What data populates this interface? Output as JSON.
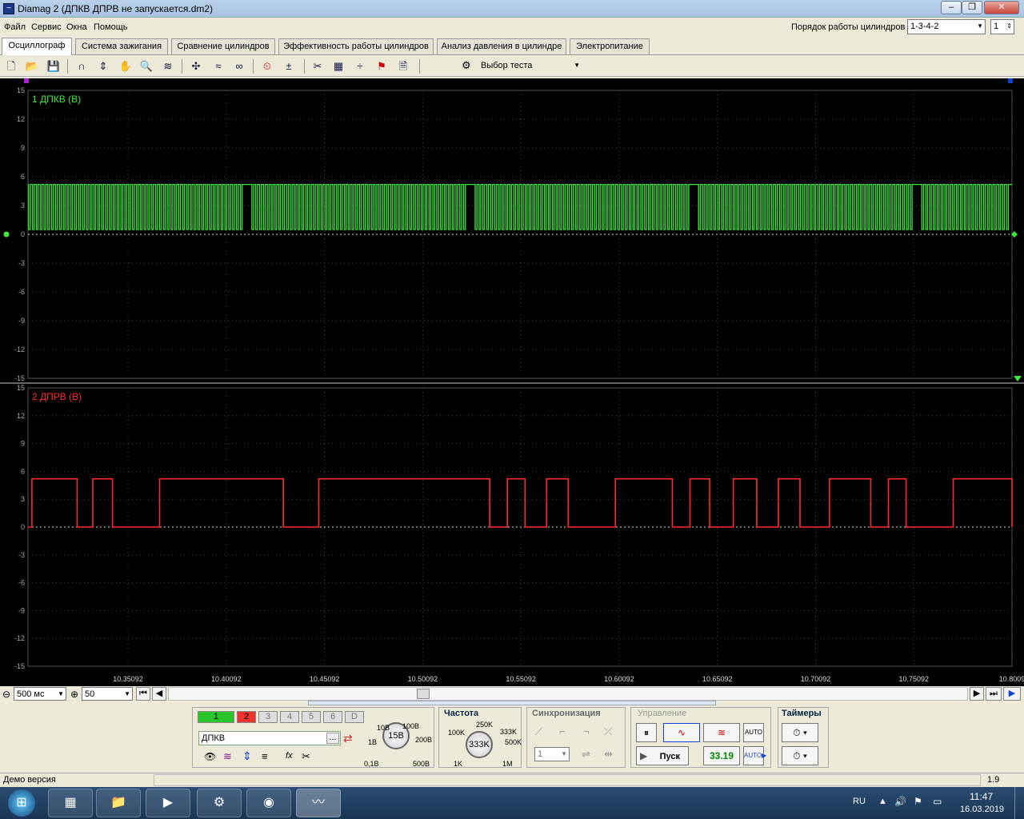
{
  "window": {
    "title": "Diamag 2 (ДПКВ ДПРВ не запускается.dm2)"
  },
  "menu": [
    "Файл",
    "Сервис",
    "Окна",
    "Помощь"
  ],
  "cyl_order": {
    "label": "Порядок работы цилиндров",
    "value": "1-3-4-2",
    "spin": "1"
  },
  "tabs": [
    "Осциллограф",
    "Система зажигания",
    "Сравнение цилиндров",
    "Эффективность работы цилиндров",
    "Анализ давления в цилиндре",
    "Электропитание"
  ],
  "toolbar": {
    "test_select": "Выбор теста"
  },
  "chart_data": [
    {
      "type": "line",
      "title": "1 ДПКВ (В)",
      "color": "#3ee83e",
      "ylim": [
        -15,
        15
      ],
      "yticks": [
        "15",
        "12",
        "9",
        "6",
        "3",
        "0",
        "-3",
        "-6",
        "-9",
        "-12",
        "-15"
      ],
      "xlim": [
        10.3,
        10.8009
      ],
      "pattern": "square wave ~5V with gaps (missing teeth)",
      "high_v": 5.2,
      "low_v": 0.5
    },
    {
      "type": "line",
      "title": "2 ДПРВ (В)",
      "color": "#ff2a2a",
      "ylim": [
        -15,
        15
      ],
      "yticks": [
        "15",
        "12",
        "9",
        "6",
        "3",
        "0",
        "-3",
        "-6",
        "-9",
        "-12",
        "-15"
      ],
      "xlim": [
        10.3,
        10.8009
      ],
      "high_v": 5.2,
      "low_v": 0.0,
      "high_segments": [
        [
          10.302,
          10.325
        ],
        [
          10.333,
          10.343
        ],
        [
          10.367,
          10.43
        ],
        [
          10.448,
          10.535
        ],
        [
          10.544,
          10.553
        ],
        [
          10.564,
          10.575
        ],
        [
          10.599,
          10.628
        ],
        [
          10.637,
          10.647
        ],
        [
          10.659,
          10.671
        ],
        [
          10.682,
          10.693
        ],
        [
          10.708,
          10.729
        ],
        [
          10.738,
          10.747
        ],
        [
          10.771,
          10.8009
        ]
      ],
      "xticks": [
        "10.35092",
        "10.40092",
        "10.45092",
        "10.50092",
        "10.55092",
        "10.60092",
        "10.65092",
        "10.70092",
        "10.75092",
        "10.8009"
      ]
    }
  ],
  "bottom": {
    "timebase": "500 мс",
    "zoom": "50"
  },
  "channels": {
    "buttons": [
      "1",
      "2",
      "3",
      "4",
      "5",
      "6",
      "D"
    ],
    "name": "ДПКВ",
    "dots": "..."
  },
  "volts_knob": {
    "value": "15В",
    "labels": [
      "10В",
      "100В",
      "1В",
      "200В",
      "0,1В",
      "500В"
    ]
  },
  "freq": {
    "title": "Частота",
    "value": "333K",
    "labels": [
      "250K",
      "100K",
      "333K",
      "500K",
      "1K",
      "1M"
    ]
  },
  "sync": {
    "title": "Синхронизация",
    "value": "1"
  },
  "control": {
    "title": "Управление",
    "start": "Пуск",
    "fps": "33.19"
  },
  "timers": {
    "title": "Таймеры"
  },
  "status": {
    "left": "Демо версия",
    "right": "1.9"
  },
  "taskbar": {
    "lang": "RU",
    "time": "11:47",
    "date": "16.03.2019"
  }
}
